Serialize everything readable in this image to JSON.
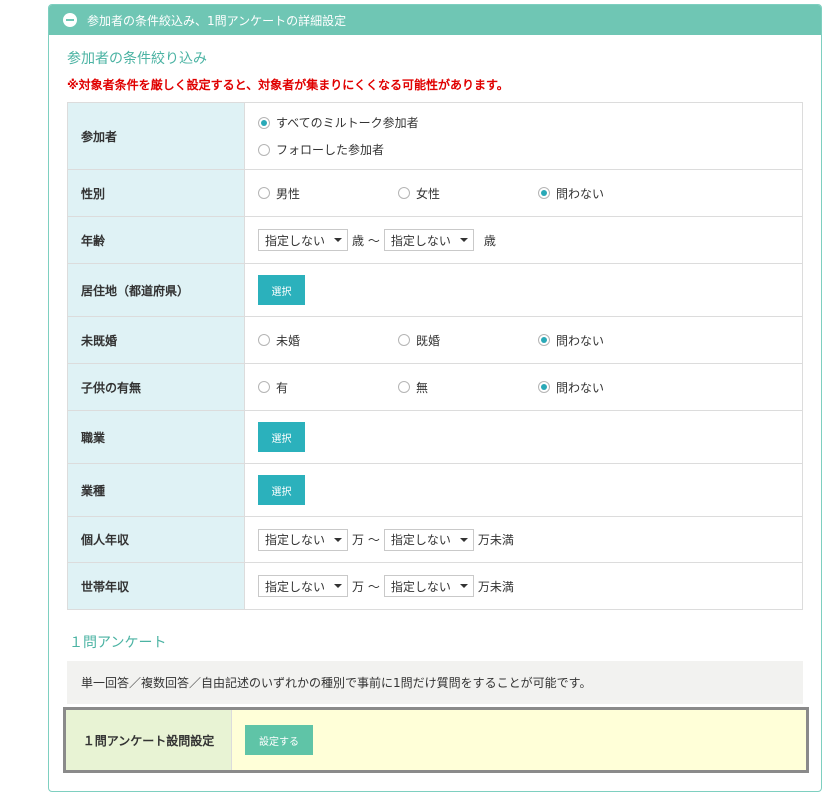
{
  "header": {
    "title": "参加者の条件絞込み、1問アンケートの詳細設定"
  },
  "filter": {
    "title": "参加者の条件絞り込み",
    "warning": "※対象者条件を厳しく設定すると、対象者が集まりにくくなる可能性があります。",
    "participants": {
      "label": "参加者",
      "options": [
        "すべてのミルトーク参加者",
        "フォローした参加者"
      ],
      "selected": 0
    },
    "gender": {
      "label": "性別",
      "options": [
        "男性",
        "女性",
        "問わない"
      ],
      "selected": 2
    },
    "age": {
      "label": "年齢",
      "from": "指定しない",
      "to": "指定しない",
      "unit_mid": "歳 〜",
      "unit_end": "歳"
    },
    "residence": {
      "label": "居住地（都道府県）",
      "button": "選択"
    },
    "marital": {
      "label": "未既婚",
      "options": [
        "未婚",
        "既婚",
        "問わない"
      ],
      "selected": 2
    },
    "children": {
      "label": "子供の有無",
      "options": [
        "有",
        "無",
        "問わない"
      ],
      "selected": 2
    },
    "occupation": {
      "label": "職業",
      "button": "選択"
    },
    "industry": {
      "label": "業種",
      "button": "選択"
    },
    "personal_income": {
      "label": "個人年収",
      "from": "指定しない",
      "to": "指定しない",
      "unit_mid": "万 〜",
      "unit_end": "万未満"
    },
    "household_income": {
      "label": "世帯年収",
      "from": "指定しない",
      "to": "指定しない",
      "unit_mid": "万 〜",
      "unit_end": "万未満"
    }
  },
  "survey": {
    "title": "１問アンケート",
    "description": "単一回答／複数回答／自由記述のいずれかの種別で事前に1問だけ質問をすることが可能です。",
    "setting_label": "１問アンケート設問設定",
    "setting_button": "設定する"
  },
  "colors": {
    "accent": "#6fc6b4",
    "label_bg": "#dff2f5",
    "button": "#2bb1bc",
    "warning": "#e00000"
  }
}
